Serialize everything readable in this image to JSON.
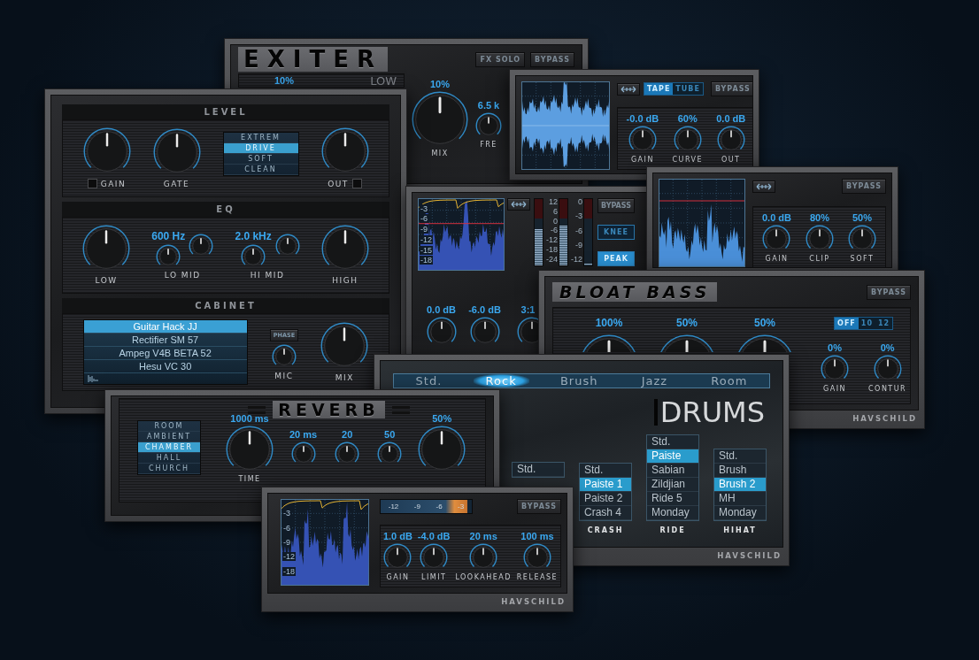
{
  "windows": [
    {
      "kind": "exiter",
      "title": "EXITER",
      "buttons": [
        "FX SOLO",
        "BYPASS"
      ],
      "band_reading": "10%",
      "band": "LOW",
      "knobs": [
        {
          "reading": "10%",
          "label": "MIX"
        },
        {
          "reading": "6.5 k",
          "label": "FRE"
        }
      ]
    },
    {
      "kind": "amp",
      "level_section": {
        "title": "LEVEL",
        "controls": [
          {
            "kind": "knob",
            "label": "GAIN",
            "checked": false
          },
          {
            "kind": "knob",
            "label": "GATE"
          },
          {
            "kind": "modes",
            "options": [
              {
                "label": "EXTREM",
                "selected": false
              },
              {
                "label": "DRIVE",
                "selected": true
              },
              {
                "label": "SOFT",
                "selected": false
              },
              {
                "label": "CLEAN",
                "selected": false
              }
            ]
          },
          {
            "kind": "knob",
            "label": "OUT",
            "checked": false
          }
        ]
      },
      "eq_section": {
        "title": "EQ",
        "controls": [
          {
            "kind": "knob",
            "label": "LOW"
          },
          {
            "kind": "band",
            "label": "LO MID",
            "reading": "600 Hz"
          },
          {
            "kind": "band",
            "label": "HI MID",
            "reading": "2.0 kHz"
          },
          {
            "kind": "knob",
            "label": "HIGH"
          }
        ]
      },
      "cabinet_section": {
        "title": "CABINET",
        "presets": [
          {
            "label": "Guitar Hack JJ",
            "selected": true
          },
          {
            "label": "Rectifier SM 57",
            "selected": false
          },
          {
            "label": "Ampeg V4B  BETA 52",
            "selected": false
          },
          {
            "label": "Hesu VC 30",
            "selected": false
          }
        ],
        "phase": {
          "label": "PHASE",
          "on": false
        },
        "knobs": [
          {
            "label": "MIC"
          },
          {
            "label": "MIX"
          }
        ]
      }
    },
    {
      "kind": "tape",
      "modes": [
        {
          "label": "TAPE",
          "selected": true
        },
        {
          "label": "TUBE",
          "selected": false
        }
      ],
      "bypass": "BYPASS",
      "knobs": [
        {
          "reading": "-0.0 dB",
          "label": "GAIN"
        },
        {
          "reading": "60%",
          "label": "CURVE"
        },
        {
          "reading": "0.0 dB",
          "label": "OUT"
        }
      ]
    },
    {
      "kind": "compressor",
      "scale": [
        "-3",
        "-6",
        "-9",
        "-12",
        "-15",
        "-18"
      ],
      "meters": [
        {
          "level": 0.55
        },
        {
          "level": 0.6
        },
        {
          "level": 0.03
        }
      ],
      "meter_scales": [
        [
          "12",
          "6",
          "0",
          "-6",
          "-12",
          "-18",
          "-24"
        ],
        [
          "0",
          "-3",
          "-6",
          "-9",
          "-12"
        ]
      ],
      "bypass": "BYPASS",
      "options": [
        {
          "label": "KNEE",
          "selected": false
        },
        {
          "label": "PEAK",
          "selected": true
        }
      ],
      "knobs": [
        {
          "reading": "0.0 dB"
        },
        {
          "reading": "-6.0 dB"
        },
        {
          "reading": "3:1"
        }
      ]
    },
    {
      "kind": "clipper",
      "bypass": "BYPASS",
      "knobs": [
        {
          "reading": "0.0 dB",
          "label": "GAIN"
        },
        {
          "reading": "80%",
          "label": "CLIP"
        },
        {
          "reading": "50%",
          "label": "SOFT"
        }
      ]
    },
    {
      "kind": "bloat",
      "title": "BLOAT BASS",
      "bypass": "BYPASS",
      "big_knobs": [
        {
          "reading": "100%"
        },
        {
          "reading": "50%"
        },
        {
          "reading": "50%"
        }
      ],
      "choices": [
        {
          "label": "OFF",
          "selected": true
        },
        {
          "label": "10",
          "selected": false
        },
        {
          "label": "12",
          "selected": false
        }
      ],
      "knobs": [
        {
          "reading": "0%",
          "label": "GAIN"
        },
        {
          "reading": "0%",
          "label": "CONTUR"
        }
      ],
      "brand": "HAVSCHILD"
    },
    {
      "kind": "drums",
      "tabs": [
        {
          "label": "Std.",
          "selected": false
        },
        {
          "label": "Rock",
          "selected": true
        },
        {
          "label": "Brush",
          "selected": false
        },
        {
          "label": "Jazz",
          "selected": false
        },
        {
          "label": "Room",
          "selected": false
        }
      ],
      "logo": "DRUMS",
      "lists": [
        {
          "options": [
            {
              "label": "Std.",
              "selected": false
            }
          ]
        },
        {
          "label": "CRASH",
          "options": [
            {
              "label": "Std.",
              "selected": false
            },
            {
              "label": "Paiste 1",
              "selected": true
            },
            {
              "label": "Paiste 2",
              "selected": false
            },
            {
              "label": "Crash 4",
              "selected": false
            }
          ]
        },
        {
          "label": "RIDE",
          "options": [
            {
              "label": "Std.",
              "selected": false
            },
            {
              "label": "Paiste",
              "selected": true
            },
            {
              "label": "Sabian",
              "selected": false
            },
            {
              "label": "Zildjian",
              "selected": false
            },
            {
              "label": "Ride 5",
              "selected": false
            },
            {
              "label": "Monday",
              "selected": false
            }
          ]
        },
        {
          "label": "HIHAT",
          "options": [
            {
              "label": "Std.",
              "selected": false
            },
            {
              "label": "Brush",
              "selected": false
            },
            {
              "label": "Brush 2",
              "selected": true
            },
            {
              "label": "MH",
              "selected": false
            },
            {
              "label": "Monday",
              "selected": false
            }
          ]
        }
      ],
      "brand": "HAVSCHILD"
    },
    {
      "kind": "reverb",
      "title": "REVERB",
      "modes": [
        {
          "label": "ROOM",
          "selected": false
        },
        {
          "label": "AMBIENT",
          "selected": false
        },
        {
          "label": "CHAMBER",
          "selected": true
        },
        {
          "label": "HALL",
          "selected": false
        },
        {
          "label": "CHURCH",
          "selected": false
        }
      ],
      "knobs": [
        {
          "kind": "large",
          "reading": "1000 ms",
          "label": "TIME"
        },
        {
          "kind": "small",
          "reading": "20 ms"
        },
        {
          "kind": "small",
          "reading": "20"
        },
        {
          "kind": "small",
          "reading": "50"
        },
        {
          "kind": "large",
          "reading": "50%"
        }
      ]
    },
    {
      "kind": "limiter",
      "scale": [
        "-3",
        "-6",
        "-9",
        "-12",
        "-18"
      ],
      "meter": {
        "level": 0.95,
        "scale": [
          "-12",
          "-9",
          "-6",
          "-3"
        ]
      },
      "bypass": "BYPASS",
      "knobs": [
        {
          "reading": "1.0 dB",
          "label": "GAIN"
        },
        {
          "reading": "-4.0 dB",
          "label": "LIMIT"
        },
        {
          "reading": "20 ms",
          "label": "LOOKAHEAD"
        },
        {
          "reading": "100 ms",
          "label": "RELEASE"
        }
      ],
      "brand": "HAVSCHILD"
    }
  ]
}
